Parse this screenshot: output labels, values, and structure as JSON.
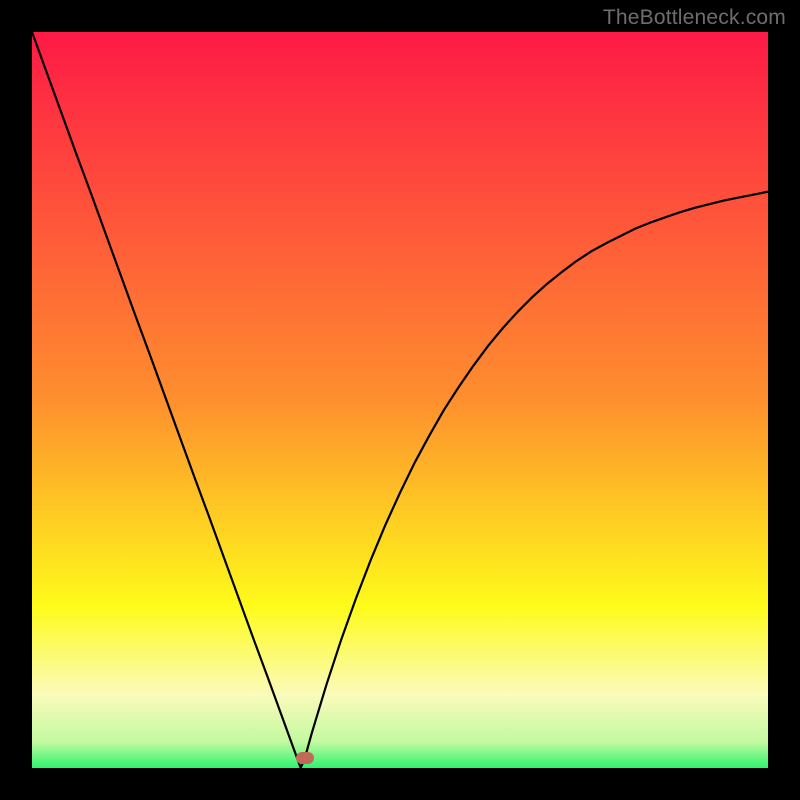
{
  "watermark": "TheBottleneck.com",
  "colors": {
    "top": "#fe1a46",
    "orange": "#fe8f2e",
    "yellow": "#fefb1a",
    "paleyellow": "#fbfbbb",
    "green": "#2cf46e",
    "marker": "#c06a58",
    "curve": "#000000",
    "frame": "#000000"
  },
  "chart_data": {
    "type": "line",
    "title": "",
    "xlabel": "",
    "ylabel": "",
    "xlim": [
      0,
      100
    ],
    "ylim": [
      0,
      100
    ],
    "x": [
      0,
      2,
      4,
      6,
      8,
      10,
      12,
      14,
      16,
      18,
      20,
      22,
      24,
      26,
      28,
      30,
      32,
      34,
      36,
      36.5,
      37,
      38,
      40,
      42,
      44,
      46,
      48,
      50,
      52,
      54,
      56,
      58,
      60,
      62,
      64,
      66,
      68,
      70,
      72,
      74,
      76,
      78,
      80,
      82,
      84,
      86,
      88,
      90,
      92,
      94,
      96,
      98,
      100
    ],
    "values": [
      100,
      94.5,
      89,
      83.5,
      78.1,
      72.6,
      67.1,
      61.6,
      56.2,
      50.7,
      45.2,
      39.7,
      34.3,
      28.8,
      23.3,
      17.8,
      12.4,
      6.9,
      1.4,
      0.03,
      1.1,
      4.7,
      11.3,
      17.4,
      23.0,
      28.2,
      33.0,
      37.4,
      41.5,
      45.2,
      48.7,
      51.8,
      54.7,
      57.4,
      59.8,
      62.0,
      64.0,
      65.8,
      67.4,
      68.9,
      70.2,
      71.3,
      72.3,
      73.3,
      74.1,
      74.8,
      75.5,
      76.1,
      76.6,
      77.1,
      77.5,
      77.9,
      78.3
    ],
    "marker": {
      "x": 37.1,
      "y": 1.3
    },
    "gradient_stops": [
      {
        "pos": 0.0,
        "color": "#fe1a46"
      },
      {
        "pos": 0.5,
        "color": "#fe8f2e"
      },
      {
        "pos": 0.78,
        "color": "#fefb1a"
      },
      {
        "pos": 0.9,
        "color": "#fbfbbb"
      },
      {
        "pos": 0.965,
        "color": "#c2f9a0"
      },
      {
        "pos": 1.0,
        "color": "#2cf46e"
      }
    ]
  }
}
